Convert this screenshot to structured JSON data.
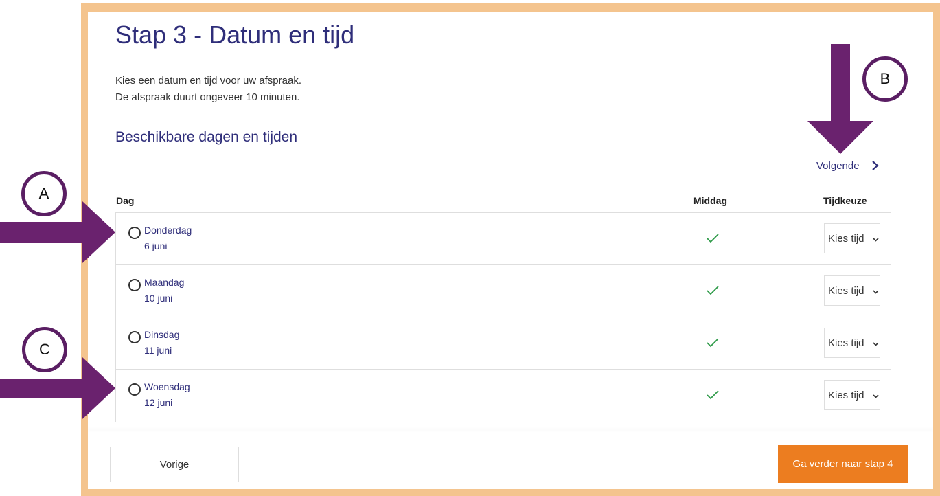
{
  "page": {
    "title": "Stap 3 - Datum en tijd",
    "intro_line1": "Kies een datum en tijd voor uw afspraak.",
    "intro_line2": "De afspraak duurt ongeveer 10 minuten.",
    "subtitle": "Beschikbare dagen en tijden",
    "next_link": "Volgende"
  },
  "table": {
    "headers": {
      "day": "Dag",
      "afternoon": "Middag",
      "time_choice": "Tijdkeuze"
    },
    "rows": [
      {
        "day": "Donderdag",
        "date": "6 juni",
        "select": "Kies tijd"
      },
      {
        "day": "Maandag",
        "date": "10 juni",
        "select": "Kies tijd"
      },
      {
        "day": "Dinsdag",
        "date": "11 juni",
        "select": "Kies tijd"
      },
      {
        "day": "Woensdag",
        "date": "12 juni",
        "select": "Kies tijd"
      }
    ]
  },
  "footer": {
    "prev_button": "Vorige",
    "next_button": "Ga verder naar stap 4"
  },
  "annotations": {
    "a": "A",
    "b": "B",
    "c": "C"
  },
  "colors": {
    "heading": "#2f2e7a",
    "accent": "#ec7d20",
    "frame": "#f4c48e",
    "arrow": "#6a226e",
    "check": "#2e9a48"
  }
}
